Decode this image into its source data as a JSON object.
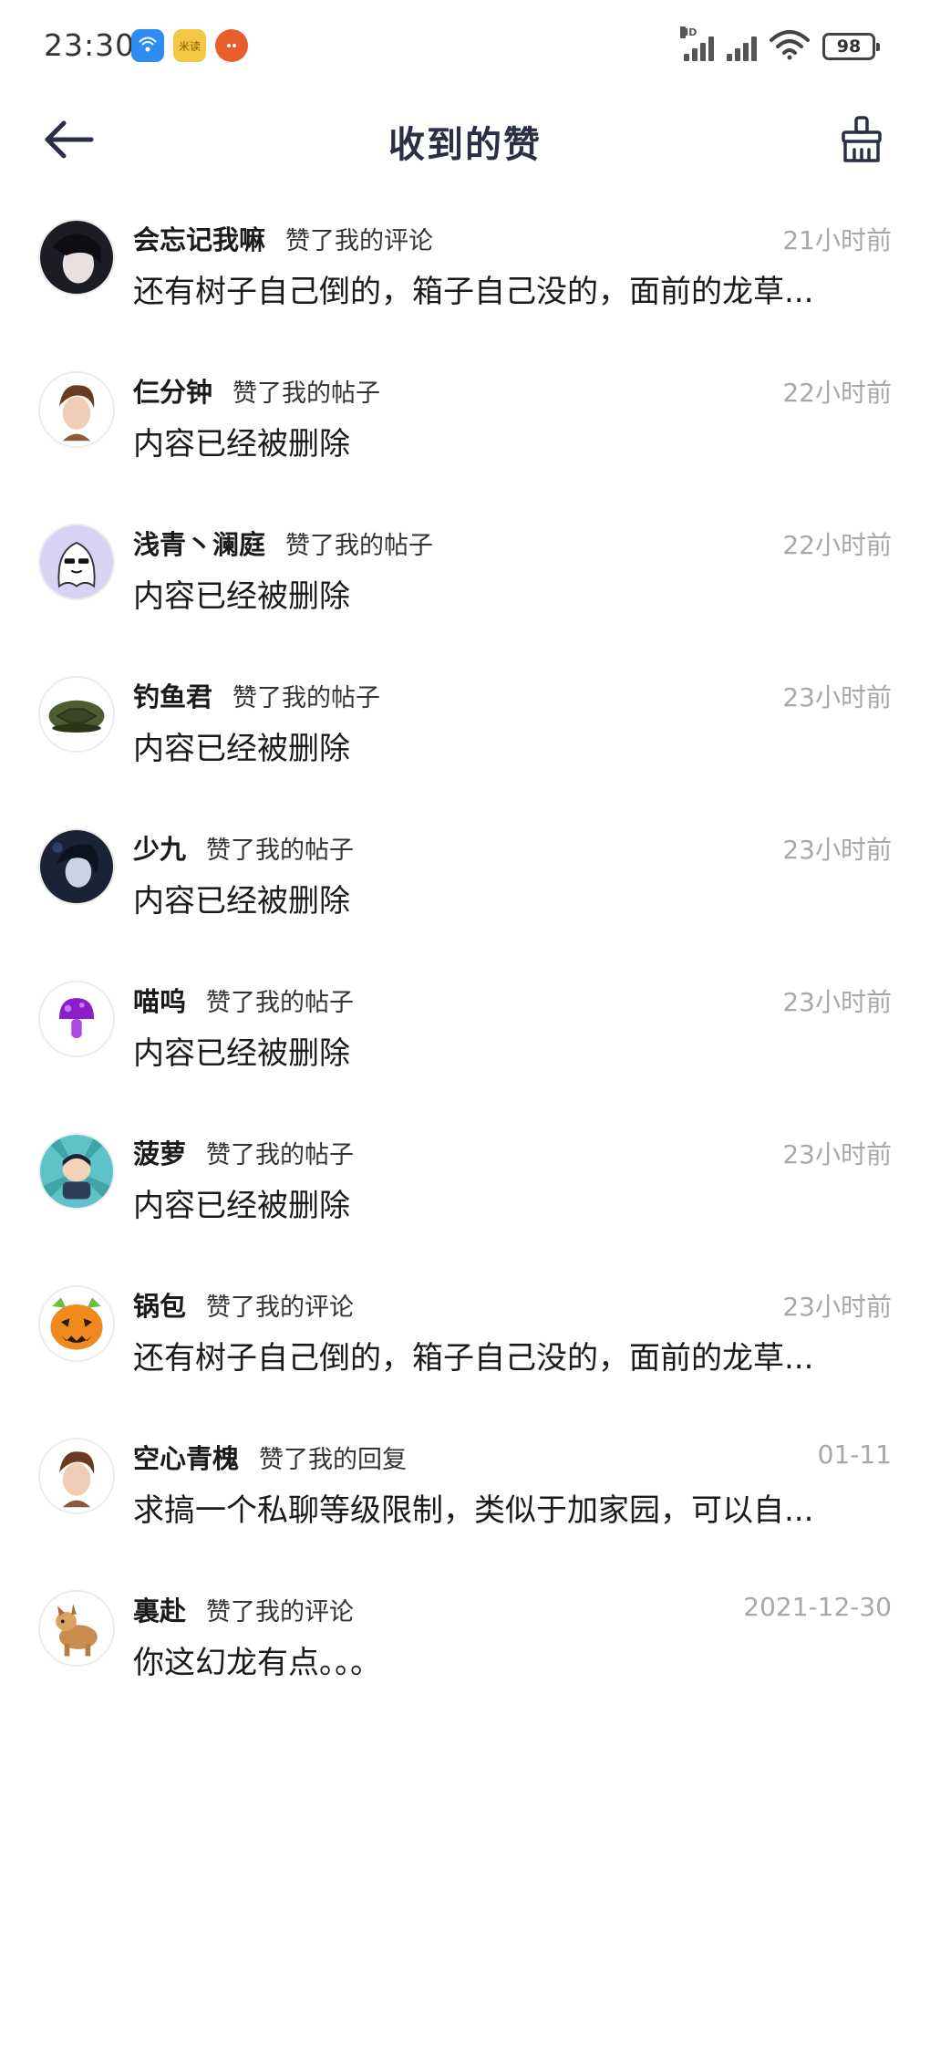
{
  "status_bar": {
    "time": "23:30",
    "hd_label": "HD",
    "battery": "98",
    "app_icon_2_text": "米读"
  },
  "header": {
    "title": "收到的赞"
  },
  "items": [
    {
      "name": "会忘记我嘛",
      "action": "赞了我的评论",
      "time": "21小时前",
      "content": "还有树子自己倒的，箱子自己没的，面前的龙草..."
    },
    {
      "name": "仨分钟",
      "action": "赞了我的帖子",
      "time": "22小时前",
      "content": "内容已经被删除"
    },
    {
      "name": "浅青丶澜庭",
      "action": "赞了我的帖子",
      "time": "22小时前",
      "content": "内容已经被删除"
    },
    {
      "name": "钓鱼君",
      "action": "赞了我的帖子",
      "time": "23小时前",
      "content": "内容已经被删除"
    },
    {
      "name": "少九",
      "action": "赞了我的帖子",
      "time": "23小时前",
      "content": "内容已经被删除"
    },
    {
      "name": "喵呜",
      "action": "赞了我的帖子",
      "time": "23小时前",
      "content": "内容已经被删除"
    },
    {
      "name": "菠萝",
      "action": "赞了我的帖子",
      "time": "23小时前",
      "content": "内容已经被删除"
    },
    {
      "name": "锅包",
      "action": "赞了我的评论",
      "time": "23小时前",
      "content": "还有树子自己倒的，箱子自己没的，面前的龙草..."
    },
    {
      "name": "空心青槐",
      "action": "赞了我的回复",
      "time": "01-11",
      "content": "求搞一个私聊等级限制，类似于加家园，可以自..."
    },
    {
      "name": "裏赴",
      "action": "赞了我的评论",
      "time": "2021-12-30",
      "content": "你这幻龙有点。。。"
    }
  ]
}
